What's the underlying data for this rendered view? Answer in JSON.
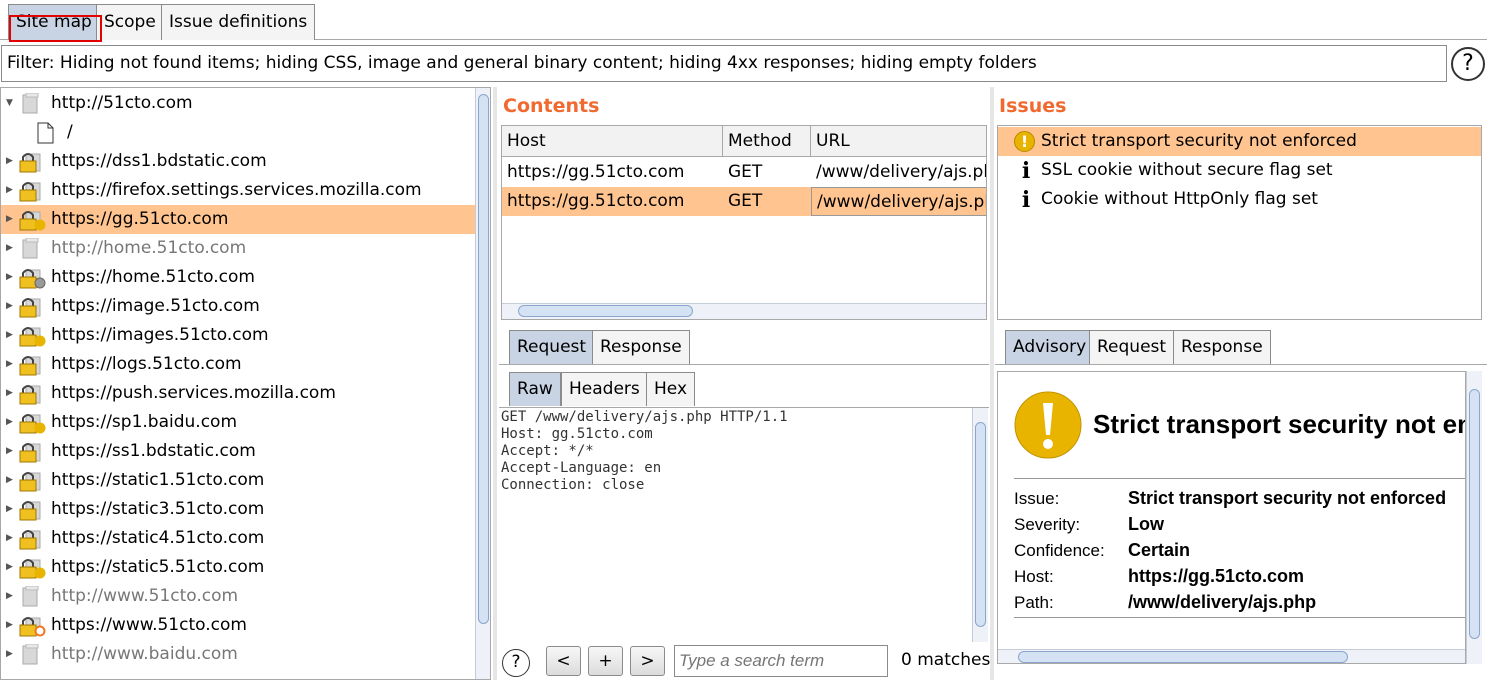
{
  "top_tabs": [
    "Site map",
    "Scope",
    "Issue definitions"
  ],
  "filter_text": "Filter: Hiding not found items;  hiding CSS, image and general binary content;  hiding 4xx responses;  hiding empty folders",
  "help_glyph": "?",
  "tree": [
    {
      "label": "http://51cto.com",
      "icon": "grey-folder-icon",
      "expanded": true,
      "grey": false
    },
    {
      "label": "/",
      "icon": "file-icon",
      "file": true
    },
    {
      "label": "https://dss1.bdstatic.com",
      "icon": "lock-folder-icon"
    },
    {
      "label": "https://firefox.settings.services.mozilla.com",
      "icon": "lock-folder-icon"
    },
    {
      "label": "https://gg.51cto.com",
      "icon": "lock-folder-yellow-dot-icon",
      "selected": true
    },
    {
      "label": "http://home.51cto.com",
      "icon": "grey-folder-icon",
      "grey": true
    },
    {
      "label": "https://home.51cto.com",
      "icon": "lock-folder-grey-dot-icon"
    },
    {
      "label": "https://image.51cto.com",
      "icon": "lock-folder-icon"
    },
    {
      "label": "https://images.51cto.com",
      "icon": "lock-folder-yellow-dot-icon"
    },
    {
      "label": "https://logs.51cto.com",
      "icon": "lock-folder-icon"
    },
    {
      "label": "https://push.services.mozilla.com",
      "icon": "lock-folder-icon"
    },
    {
      "label": "https://sp1.baidu.com",
      "icon": "lock-folder-yellow-dot-icon"
    },
    {
      "label": "https://ss1.bdstatic.com",
      "icon": "lock-folder-icon"
    },
    {
      "label": "https://static1.51cto.com",
      "icon": "lock-folder-icon"
    },
    {
      "label": "https://static3.51cto.com",
      "icon": "lock-folder-icon"
    },
    {
      "label": "https://static4.51cto.com",
      "icon": "lock-folder-icon"
    },
    {
      "label": "https://static5.51cto.com",
      "icon": "lock-folder-yellow-dot-icon"
    },
    {
      "label": "http://www.51cto.com",
      "icon": "grey-folder-icon",
      "grey": true
    },
    {
      "label": "https://www.51cto.com",
      "icon": "lock-folder-orange-ring-icon"
    },
    {
      "label": "http://www.baidu.com",
      "icon": "grey-folder-icon",
      "grey": true
    }
  ],
  "contents": {
    "title": "Contents",
    "columns": [
      "Host",
      "Method",
      "URL"
    ],
    "rows": [
      {
        "host": "https://gg.51cto.com",
        "method": "GET",
        "url": "/www/delivery/ajs.php"
      },
      {
        "host": "https://gg.51cto.com",
        "method": "GET",
        "url": "/www/delivery/ajs.php",
        "selected": true
      }
    ]
  },
  "issues": {
    "title": "Issues",
    "items": [
      {
        "label": "Strict transport security not enforced",
        "icon": "warning-icon",
        "selected": true
      },
      {
        "label": "SSL cookie without secure flag set",
        "icon": "info-icon"
      },
      {
        "label": "Cookie without HttpOnly flag set",
        "icon": "info-icon"
      }
    ]
  },
  "request_tabs": [
    "Request",
    "Response"
  ],
  "raw_tabs": [
    "Raw",
    "Headers",
    "Hex"
  ],
  "raw_request": [
    "GET /www/delivery/ajs.php HTTP/1.1",
    "Host: gg.51cto.com",
    "Accept: */*",
    "Accept-Language: en",
    "Connection: close"
  ],
  "search_bar": {
    "prev": "<",
    "add": "+",
    "next": ">",
    "placeholder": "Type a search term",
    "matches": "0 matches"
  },
  "advisory_tabs": [
    "Advisory",
    "Request",
    "Response"
  ],
  "advisory": {
    "title": "Strict transport security not enforced",
    "fields": [
      {
        "label": "Issue:",
        "value": "Strict transport security not enforced"
      },
      {
        "label": "Severity:",
        "value": "Low"
      },
      {
        "label": "Confidence:",
        "value": "Certain"
      },
      {
        "label": "Host:",
        "value": "https://gg.51cto.com"
      },
      {
        "label": "Path:",
        "value": "/www/delivery/ajs.php"
      }
    ]
  },
  "colors": {
    "selection": "#ffc48f",
    "section_title": "#f06a30",
    "active_tab": "#c8d4e4",
    "warning": "#e8b400"
  }
}
